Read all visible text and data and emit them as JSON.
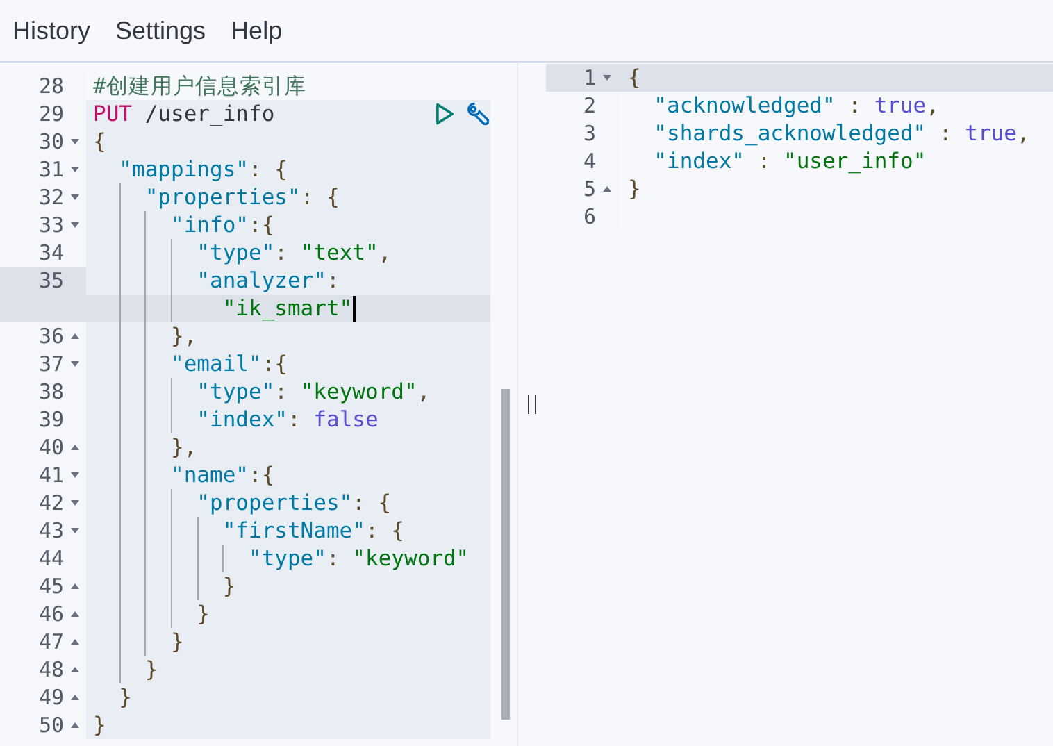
{
  "menu": [
    {
      "label": "History"
    },
    {
      "label": "Settings"
    },
    {
      "label": "Help"
    }
  ],
  "request_editor": {
    "rows": [
      {
        "number": "28",
        "fold_start": false,
        "fold_end": false,
        "selected": false,
        "active": false,
        "tokens": [
          {
            "kind": "comment",
            "text": "#创建用户信息索引库"
          }
        ]
      },
      {
        "number": "29",
        "fold_start": false,
        "fold_end": false,
        "selected": true,
        "active": false,
        "tokens": [
          {
            "kind": "method",
            "text": "PUT"
          },
          {
            "kind": "path",
            "text": " /user_info"
          }
        ]
      },
      {
        "number": "30",
        "fold_start": true,
        "fold_end": false,
        "selected": true,
        "active": false,
        "tokens": [
          {
            "kind": "punct",
            "text": "{"
          }
        ]
      },
      {
        "number": "31",
        "fold_start": true,
        "fold_end": false,
        "selected": true,
        "active": false,
        "tokens": [
          {
            "kind": "key",
            "text": "  \"mappings\""
          },
          {
            "kind": "punct",
            "text": ": {"
          }
        ]
      },
      {
        "number": "32",
        "fold_start": true,
        "fold_end": false,
        "selected": true,
        "active": false,
        "tokens": [
          {
            "kind": "key",
            "text": "    \"properties\""
          },
          {
            "kind": "punct",
            "text": ": {"
          }
        ]
      },
      {
        "number": "33",
        "fold_start": true,
        "fold_end": false,
        "selected": true,
        "active": false,
        "tokens": [
          {
            "kind": "key",
            "text": "      \"info\""
          },
          {
            "kind": "punct",
            "text": ":{"
          }
        ]
      },
      {
        "number": "34",
        "fold_start": false,
        "fold_end": false,
        "selected": true,
        "active": false,
        "tokens": [
          {
            "kind": "key",
            "text": "        \"type\""
          },
          {
            "kind": "punct",
            "text": ": "
          },
          {
            "kind": "string",
            "text": "\"text\""
          },
          {
            "kind": "punct",
            "text": ","
          }
        ]
      },
      {
        "number": "35",
        "fold_start": false,
        "fold_end": false,
        "selected": true,
        "active": true,
        "tokens": [
          {
            "kind": "key",
            "text": "        \"analyzer\""
          },
          {
            "kind": "punct",
            "text": ":"
          }
        ]
      },
      {
        "fold_start": false,
        "fold_end": false,
        "selected": true,
        "active": true,
        "cursor": true,
        "tokens": [
          {
            "kind": "string",
            "text": "          \"ik_smart\""
          }
        ]
      },
      {
        "number": "36",
        "fold_start": false,
        "fold_end": true,
        "selected": true,
        "active": false,
        "tokens": [
          {
            "kind": "punct",
            "text": "      },"
          }
        ]
      },
      {
        "number": "37",
        "fold_start": true,
        "fold_end": false,
        "selected": true,
        "active": false,
        "tokens": [
          {
            "kind": "key",
            "text": "      \"email\""
          },
          {
            "kind": "punct",
            "text": ":{"
          }
        ]
      },
      {
        "number": "38",
        "fold_start": false,
        "fold_end": false,
        "selected": true,
        "active": false,
        "tokens": [
          {
            "kind": "key",
            "text": "        \"type\""
          },
          {
            "kind": "punct",
            "text": ": "
          },
          {
            "kind": "string",
            "text": "\"keyword\""
          },
          {
            "kind": "punct",
            "text": ","
          }
        ]
      },
      {
        "number": "39",
        "fold_start": false,
        "fold_end": false,
        "selected": true,
        "active": false,
        "tokens": [
          {
            "kind": "key",
            "text": "        \"index\""
          },
          {
            "kind": "punct",
            "text": ": "
          },
          {
            "kind": "bool",
            "text": "false"
          }
        ]
      },
      {
        "number": "40",
        "fold_start": false,
        "fold_end": true,
        "selected": true,
        "active": false,
        "tokens": [
          {
            "kind": "punct",
            "text": "      },"
          }
        ]
      },
      {
        "number": "41",
        "fold_start": true,
        "fold_end": false,
        "selected": true,
        "active": false,
        "tokens": [
          {
            "kind": "key",
            "text": "      \"name\""
          },
          {
            "kind": "punct",
            "text": ":{"
          }
        ]
      },
      {
        "number": "42",
        "fold_start": true,
        "fold_end": false,
        "selected": true,
        "active": false,
        "tokens": [
          {
            "kind": "key",
            "text": "        \"properties\""
          },
          {
            "kind": "punct",
            "text": ": {"
          }
        ]
      },
      {
        "number": "43",
        "fold_start": true,
        "fold_end": false,
        "selected": true,
        "active": false,
        "tokens": [
          {
            "kind": "key",
            "text": "          \"firstName\""
          },
          {
            "kind": "punct",
            "text": ": {"
          }
        ]
      },
      {
        "number": "44",
        "fold_start": false,
        "fold_end": false,
        "selected": true,
        "active": false,
        "tokens": [
          {
            "kind": "key",
            "text": "            \"type\""
          },
          {
            "kind": "punct",
            "text": ": "
          },
          {
            "kind": "string",
            "text": "\"keyword\""
          }
        ]
      },
      {
        "number": "45",
        "fold_start": false,
        "fold_end": true,
        "selected": true,
        "active": false,
        "tokens": [
          {
            "kind": "punct",
            "text": "          }"
          }
        ]
      },
      {
        "number": "46",
        "fold_start": false,
        "fold_end": true,
        "selected": true,
        "active": false,
        "tokens": [
          {
            "kind": "punct",
            "text": "        }"
          }
        ]
      },
      {
        "number": "47",
        "fold_start": false,
        "fold_end": true,
        "selected": true,
        "active": false,
        "tokens": [
          {
            "kind": "punct",
            "text": "      }"
          }
        ]
      },
      {
        "number": "48",
        "fold_start": false,
        "fold_end": true,
        "selected": true,
        "active": false,
        "tokens": [
          {
            "kind": "punct",
            "text": "    }"
          }
        ]
      },
      {
        "number": "49",
        "fold_start": false,
        "fold_end": true,
        "selected": true,
        "active": false,
        "tokens": [
          {
            "kind": "punct",
            "text": "  }"
          }
        ]
      },
      {
        "number": "50",
        "fold_start": false,
        "fold_end": true,
        "selected": true,
        "active": false,
        "tokens": [
          {
            "kind": "punct",
            "text": "}"
          }
        ]
      }
    ]
  },
  "response_viewer": {
    "rows": [
      {
        "number": "1",
        "fold_start": true,
        "fold_end": false,
        "active": true,
        "tokens": [
          {
            "kind": "punct",
            "text": "{"
          }
        ]
      },
      {
        "number": "2",
        "fold_start": false,
        "fold_end": false,
        "active": false,
        "tokens": [
          {
            "kind": "key",
            "text": "  \"acknowledged\""
          },
          {
            "kind": "punct",
            "text": " : "
          },
          {
            "kind": "bool",
            "text": "true"
          },
          {
            "kind": "punct",
            "text": ","
          }
        ]
      },
      {
        "number": "3",
        "fold_start": false,
        "fold_end": false,
        "active": false,
        "tokens": [
          {
            "kind": "key",
            "text": "  \"shards_acknowledged\""
          },
          {
            "kind": "punct",
            "text": " : "
          },
          {
            "kind": "bool",
            "text": "true"
          },
          {
            "kind": "punct",
            "text": ","
          }
        ]
      },
      {
        "number": "4",
        "fold_start": false,
        "fold_end": false,
        "active": false,
        "tokens": [
          {
            "kind": "key",
            "text": "  \"index\""
          },
          {
            "kind": "punct",
            "text": " : "
          },
          {
            "kind": "string",
            "text": "\"user_info\""
          }
        ]
      },
      {
        "number": "5",
        "fold_start": false,
        "fold_end": true,
        "active": false,
        "tokens": [
          {
            "kind": "punct",
            "text": "}"
          }
        ]
      },
      {
        "number": "6",
        "fold_start": false,
        "fold_end": false,
        "active": false
      }
    ]
  }
}
